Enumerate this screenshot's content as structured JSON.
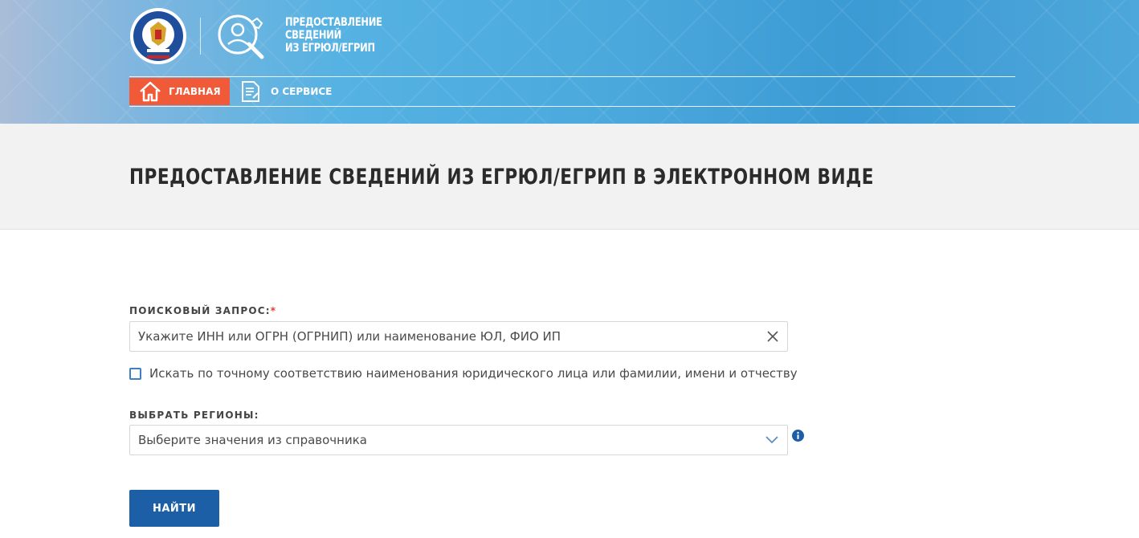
{
  "header": {
    "service_title_line1": "ПРЕДОСТАВЛЕНИЕ",
    "service_title_line2": "СВЕДЕНИЙ",
    "service_title_line3": "ИЗ ЕГРЮЛ/ЕГРИП",
    "nav": {
      "home_label": "ГЛАВНАЯ",
      "about_label": "О СЕРВИСЕ"
    },
    "colors": {
      "nav_active": "#f15a38",
      "band_start": "#a9bdd8",
      "band_end": "#3c9ad4"
    }
  },
  "page": {
    "title": "ПРЕДОСТАВЛЕНИЕ СВЕДЕНИЙ ИЗ ЕГРЮЛ/ЕГРИП В ЭЛЕКТРОННОМ ВИДЕ"
  },
  "form": {
    "search_label": "ПОИСКОВЫЙ ЗАПРОС:",
    "required_mark": "*",
    "search_value": "",
    "search_placeholder": "Укажите ИНН или ОГРН (ОГРНИП) или наименование ЮЛ, ФИО ИП",
    "exact_match_label": "Искать по точному соответствию наименования юридического лица или фамилии, имени и отчеству",
    "exact_match_checked": false,
    "regions_label": "ВЫБРАТЬ РЕГИОНЫ:",
    "regions_value": "Выберите значения из справочника",
    "submit_label": "НАЙТИ",
    "icons": {
      "clear": "close-icon",
      "dropdown": "chevron-down-icon",
      "info": "info-icon",
      "home": "house-icon",
      "about": "document-icon"
    },
    "colors": {
      "submit": "#1d5fa6",
      "checkbox": "#3f7fc4",
      "required": "#e53935"
    }
  }
}
